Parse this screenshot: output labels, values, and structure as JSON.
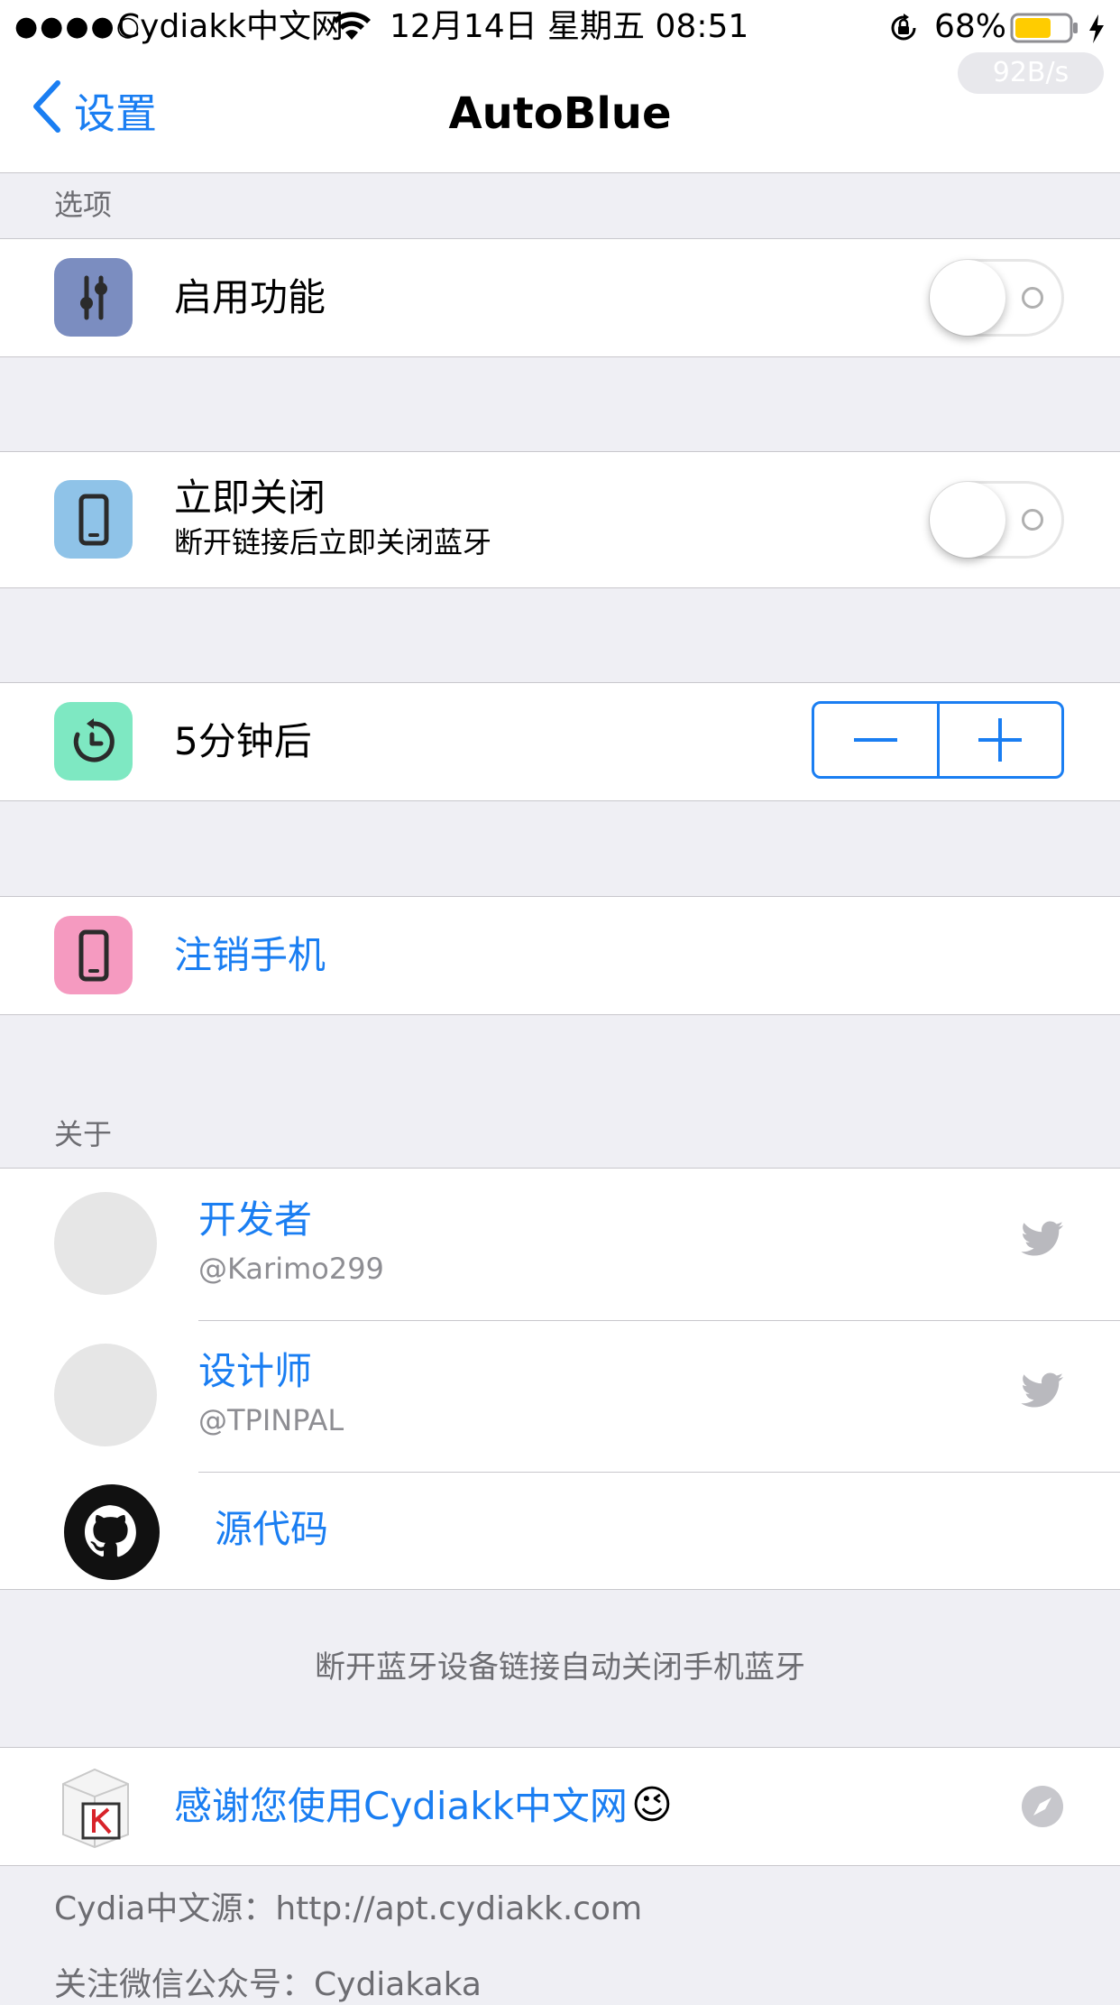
{
  "status_bar": {
    "signal": "●●●●○",
    "carrier": "Cydiakk中文网",
    "datetime": "12月14日 星期五 08:51",
    "battery_percent": "68%",
    "battery_level": 0.68,
    "net_speed": "92B/s"
  },
  "nav": {
    "back_label": "设置",
    "title": "AutoBlue"
  },
  "options": {
    "header": "选项",
    "enable_label": "启用功能",
    "enable_on": false,
    "close_now_label": "立即关闭",
    "close_now_sub": "断开链接后立即关闭蓝牙",
    "close_now_on": false,
    "delay_label": "5分钟后",
    "stepper_minus": "−",
    "stepper_plus": "+",
    "logout_label": "注销手机"
  },
  "about": {
    "header": "关于",
    "developer_label": "开发者",
    "developer_handle": "@Karimo299",
    "designer_label": "设计师",
    "designer_handle": "@TPINPAL",
    "source_label": "源代码"
  },
  "footer": {
    "description": "断开蓝牙设备链接自动关闭手机蓝牙",
    "thanks_label": "感谢您使用Cydiakk中文网",
    "thanks_emoji": "😉",
    "source_line": "Cydia中文源：http://apt.cydiakk.com",
    "wechat_line": "关注微信公众号：Cydiakaka"
  },
  "colors": {
    "accent": "#1a7ef2",
    "icon_sliders": "#7b8dc0",
    "icon_phone_blue": "#8fc3e8",
    "icon_timer": "#7ee8c2",
    "icon_phone_pink": "#f59ac0",
    "battery": "#ffcc00"
  }
}
